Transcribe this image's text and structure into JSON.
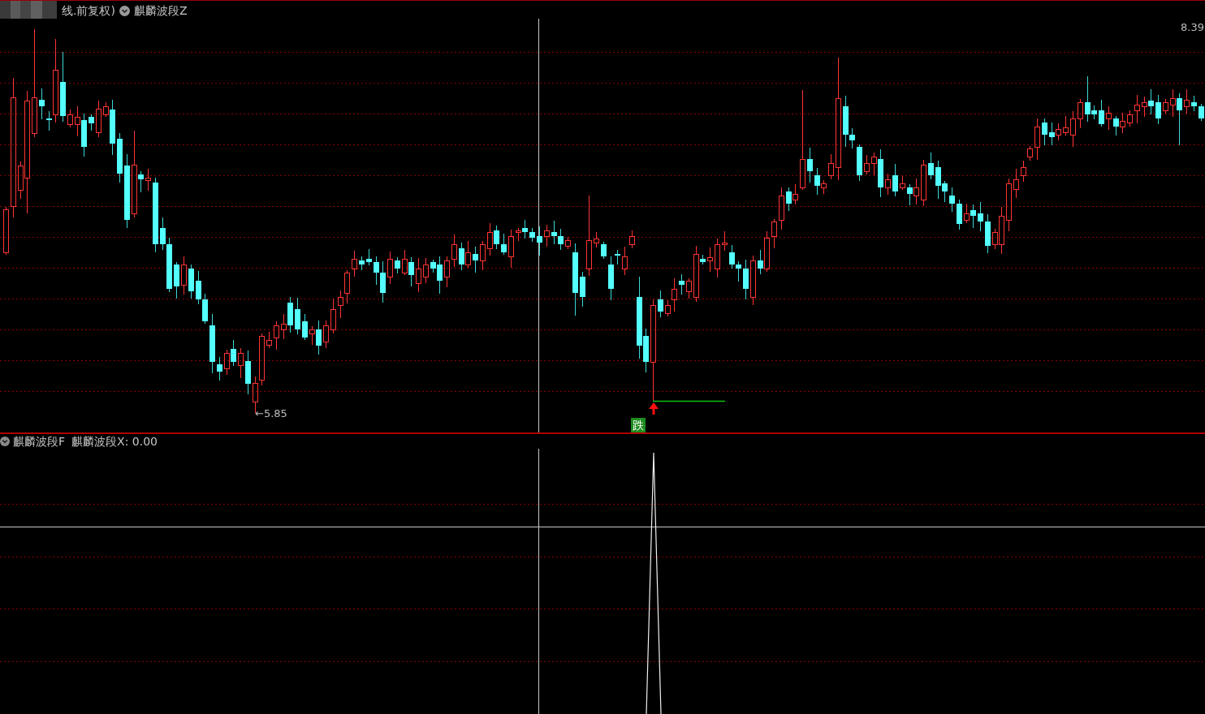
{
  "chart_header": {
    "title": "线.前复权)",
    "indicator": "麒麟波段Z"
  },
  "price_scale": {
    "top_label": "8.39"
  },
  "markers": {
    "low_label": "←5.85",
    "signal_tag": "跌"
  },
  "sub_chart_header": {
    "indicator": "麒麟波段F",
    "reading": "麒麟波段X: 0.00"
  }
}
